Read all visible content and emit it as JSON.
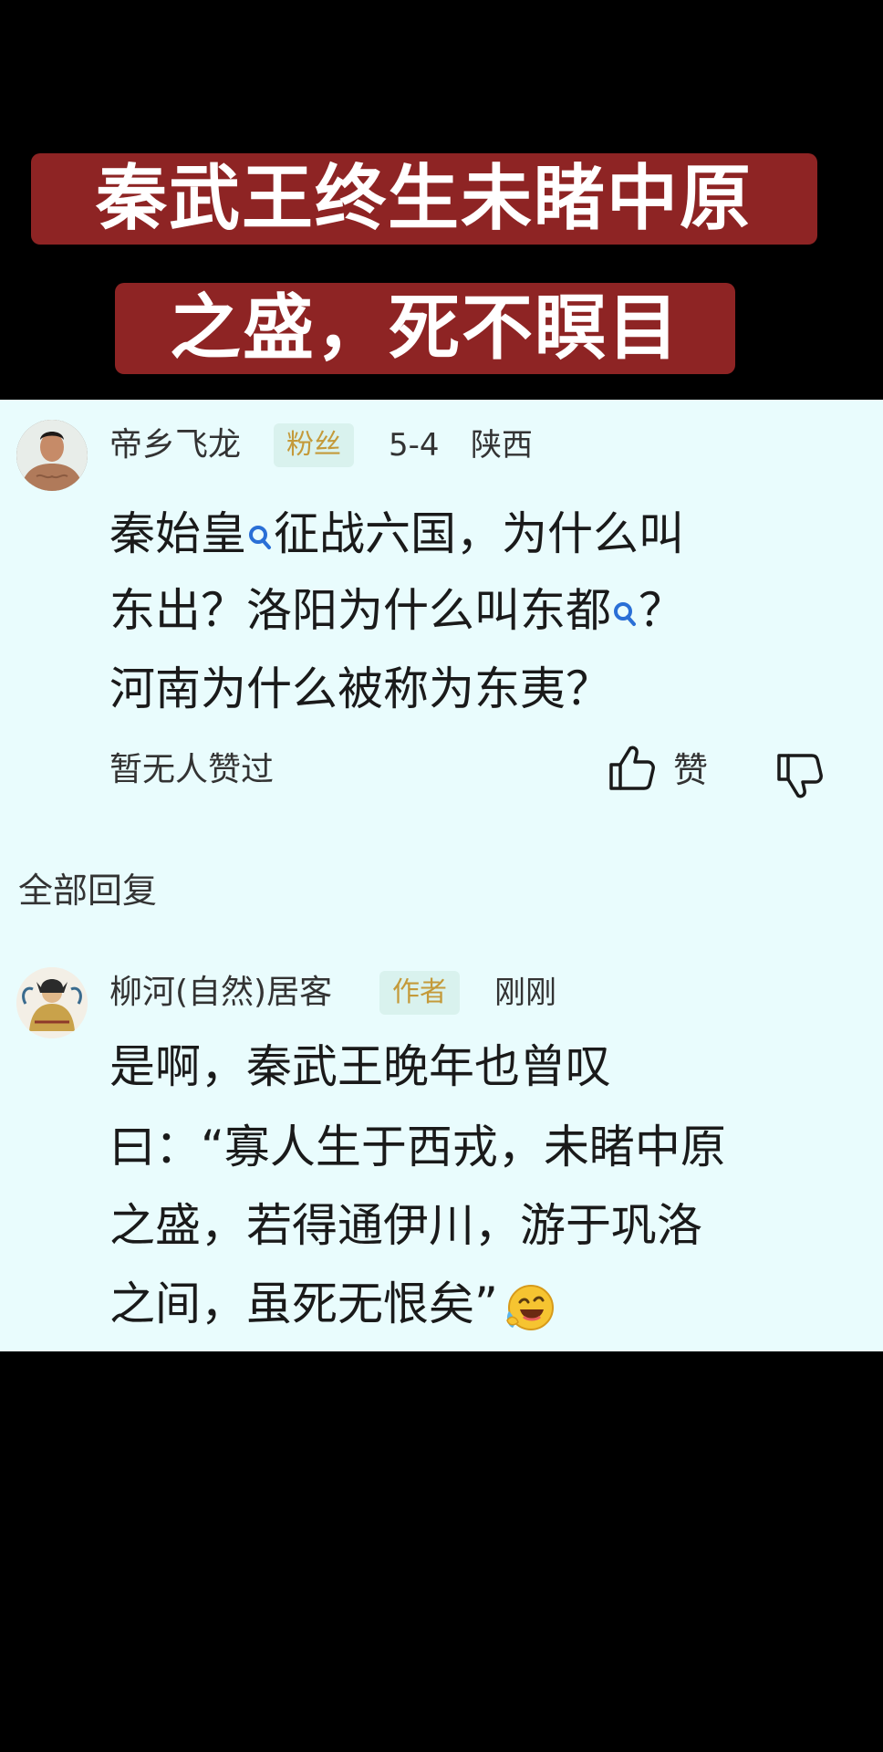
{
  "title": {
    "line1": "秦武王终生未睹中原",
    "line2": "之盛，死不瞑目"
  },
  "comment": {
    "username": "帝乡飞龙",
    "badge": "粉丝",
    "date": "5-4",
    "location": "陕西",
    "body": {
      "line1_a": "秦始皇",
      "line1_b": "征战六国，为什么叫",
      "line2_a": "东出？洛阳为什么叫东都",
      "line2_b": "？",
      "line3": "河南为什么被称为东夷？"
    },
    "likes_status": "暂无人赞过",
    "like_label": "赞",
    "icons": {
      "search": "search-icon",
      "like": "thumbs-up-icon",
      "dislike": "thumbs-down-icon",
      "avatar": "user-avatar"
    }
  },
  "replies_header": "全部回复",
  "reply": {
    "username": "柳河(自然)居客",
    "badge": "作者",
    "time": "刚刚",
    "body": {
      "line1": "是啊，秦武王晚年也曾叹",
      "line2": "曰：“寡人生于西戎，未睹中原",
      "line3": "之盛，若得通伊川，游于巩洛",
      "line4": "之间，虽死无恨矣”"
    },
    "emoji": "laughing-crying-emoji"
  },
  "colors": {
    "title_bg": "#8e2424",
    "panel_bg": "#e9fcfd",
    "badge_text": "#c49a3a",
    "badge_bg": "#d9f2ee",
    "search_icon": "#2a6fd6"
  }
}
